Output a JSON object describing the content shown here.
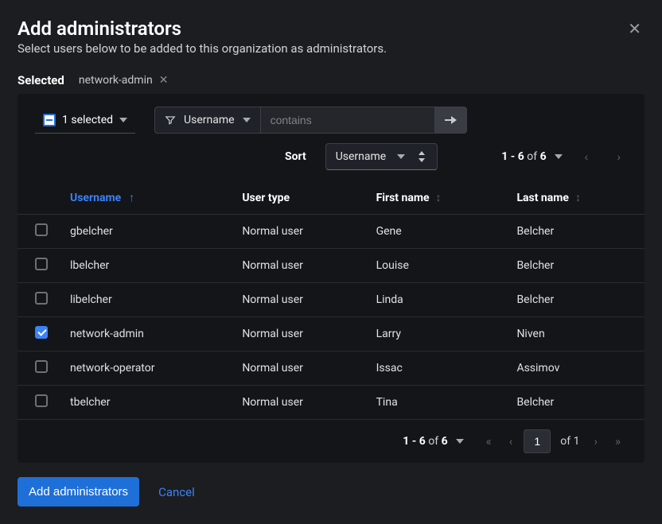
{
  "modal": {
    "title": "Add administrators",
    "subtitle": "Select users below to be added to this organization as administrators."
  },
  "selected": {
    "label": "Selected",
    "chips": [
      {
        "text": "network-admin"
      }
    ]
  },
  "toolbar": {
    "selection_summary": "1 selected",
    "filter_field": "Username",
    "filter_operator_placeholder": "contains",
    "sort_label": "Sort",
    "sort_field": "Username",
    "range_text_prefix": "1 - 6",
    "range_text_of": "of",
    "range_text_total": "6"
  },
  "columns": {
    "username": "Username",
    "usertype": "User type",
    "firstname": "First name",
    "lastname": "Last name"
  },
  "rows": [
    {
      "checked": false,
      "username": "gbelcher",
      "usertype": "Normal user",
      "firstname": "Gene",
      "lastname": "Belcher"
    },
    {
      "checked": false,
      "username": "lbelcher",
      "usertype": "Normal user",
      "firstname": "Louise",
      "lastname": "Belcher"
    },
    {
      "checked": false,
      "username": "libelcher",
      "usertype": "Normal user",
      "firstname": "Linda",
      "lastname": "Belcher"
    },
    {
      "checked": true,
      "username": "network-admin",
      "usertype": "Normal user",
      "firstname": "Larry",
      "lastname": "Niven"
    },
    {
      "checked": false,
      "username": "network-operator",
      "usertype": "Normal user",
      "firstname": "Issac",
      "lastname": "Assimov"
    },
    {
      "checked": false,
      "username": "tbelcher",
      "usertype": "Normal user",
      "firstname": "Tina",
      "lastname": "Belcher"
    }
  ],
  "pager": {
    "range_prefix": "1 - 6",
    "of": "of",
    "total": "6",
    "page": "1",
    "page_of": "of",
    "page_total": "1"
  },
  "actions": {
    "primary": "Add administrators",
    "cancel": "Cancel"
  }
}
